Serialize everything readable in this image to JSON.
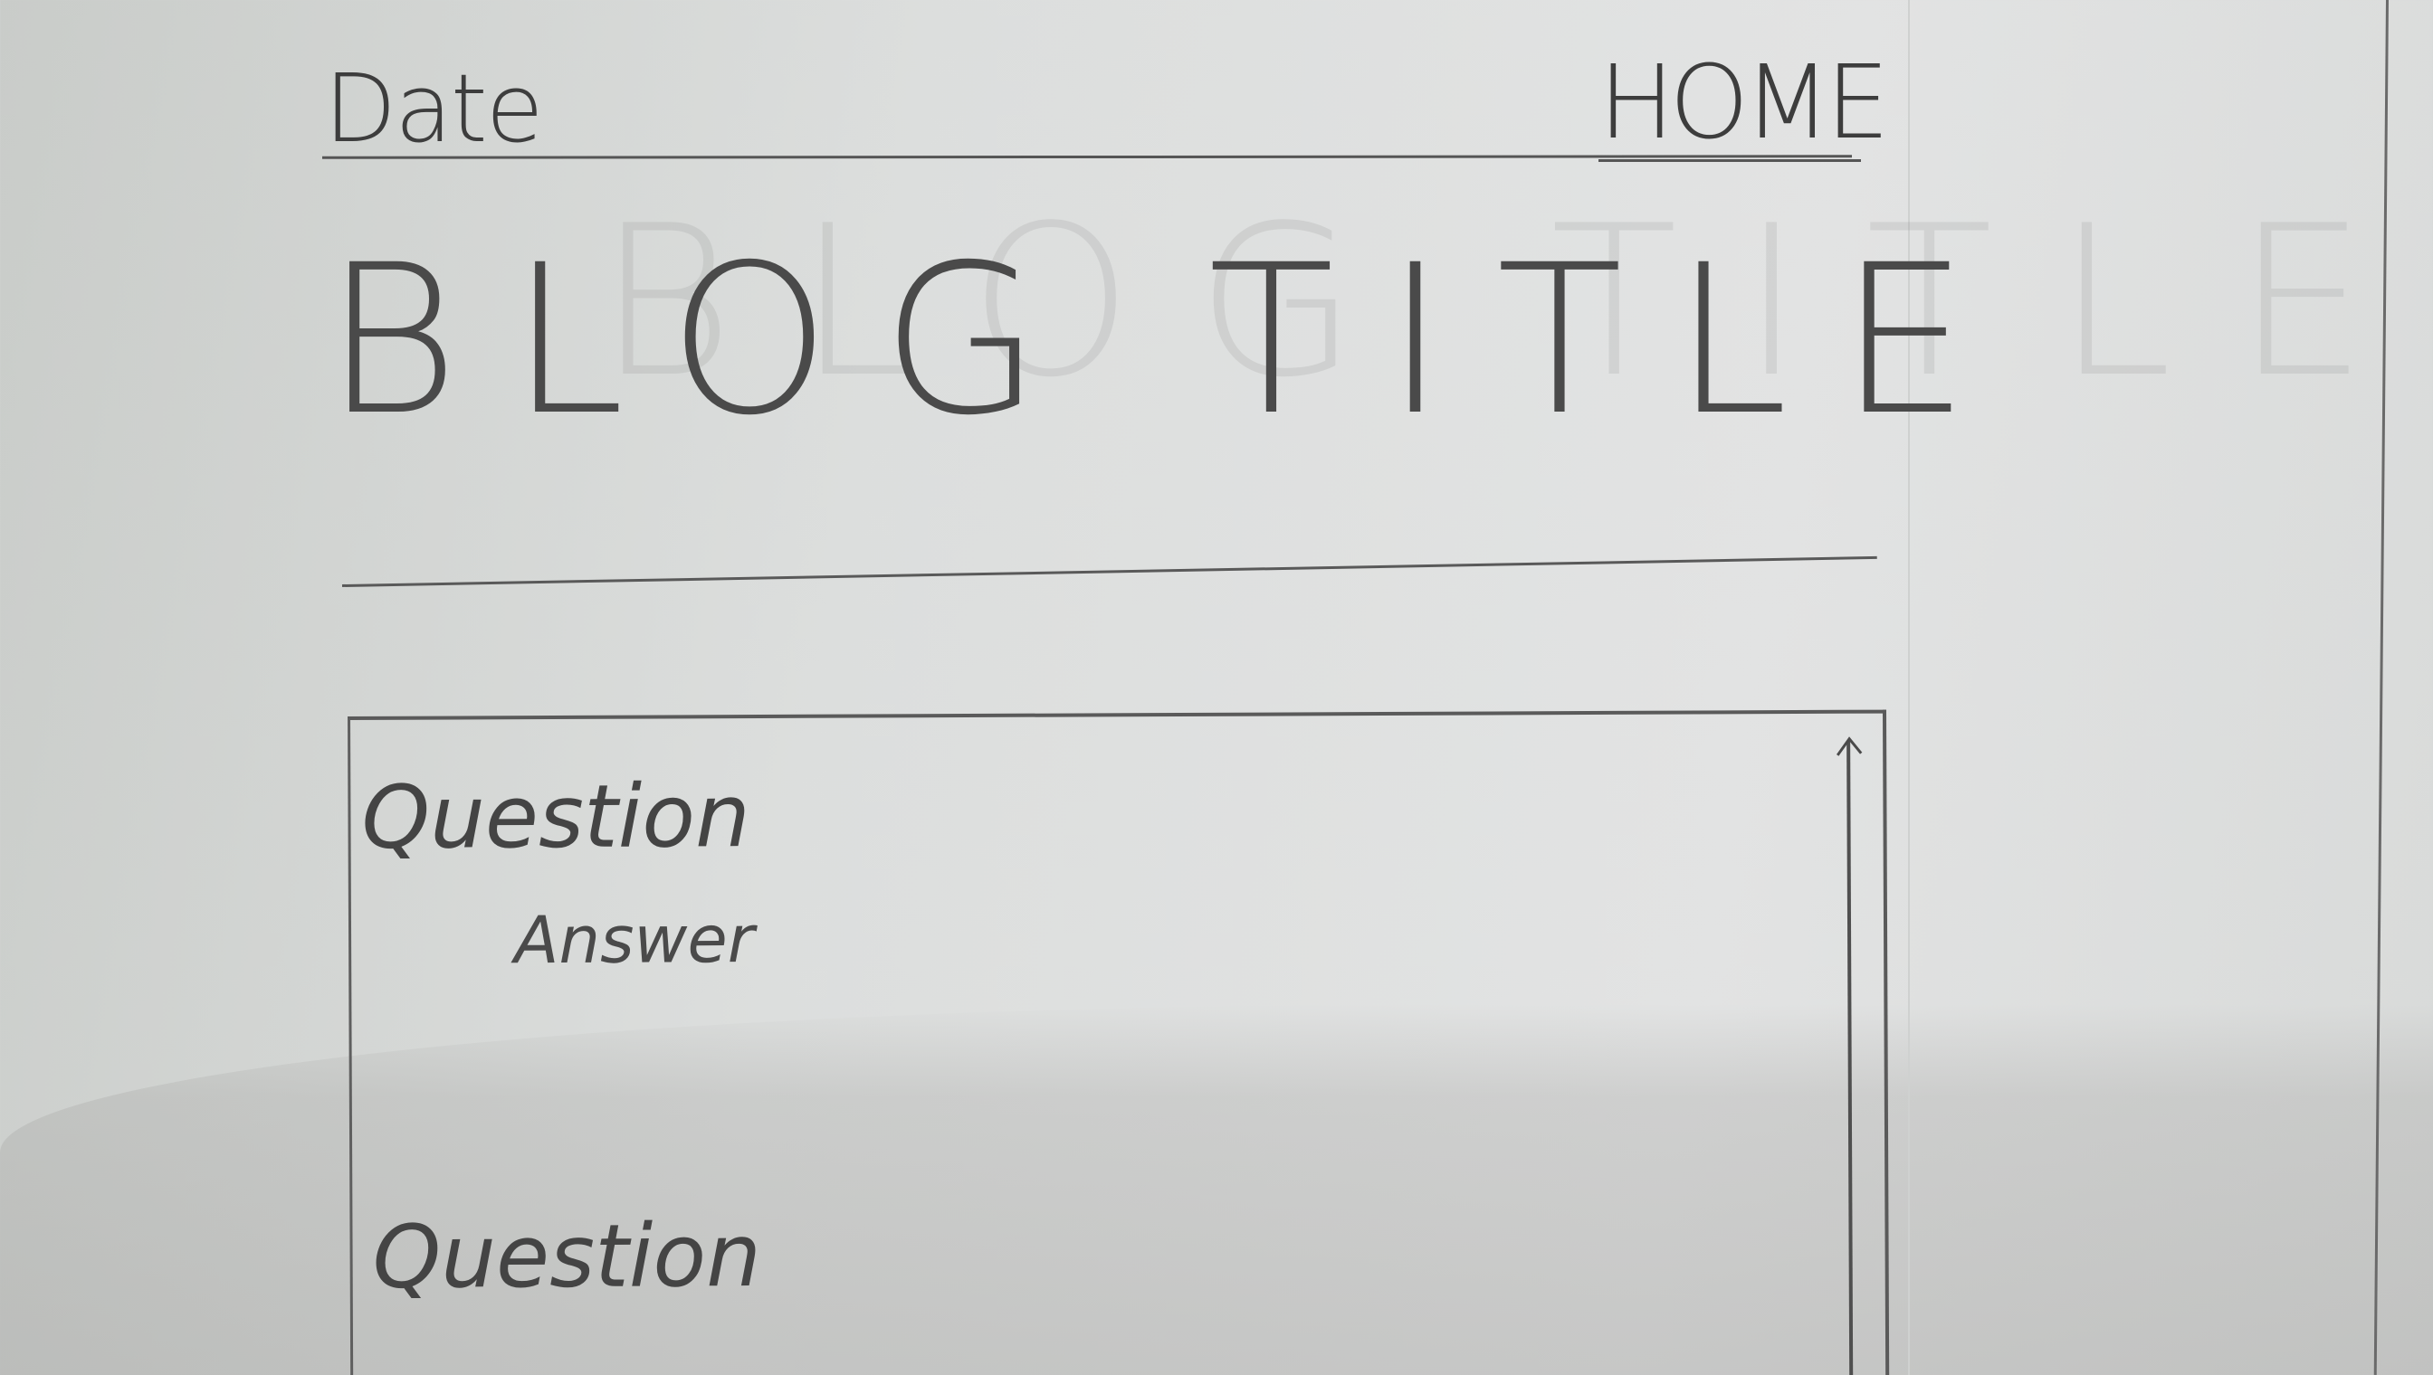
{
  "header": {
    "date_label": "Date",
    "home_link": "HOME"
  },
  "blog": {
    "title": "BLOG TITLE"
  },
  "qa_list": {
    "items": [
      {
        "question": "Question",
        "answer": "Answer"
      },
      {
        "question": "Question"
      }
    ]
  }
}
